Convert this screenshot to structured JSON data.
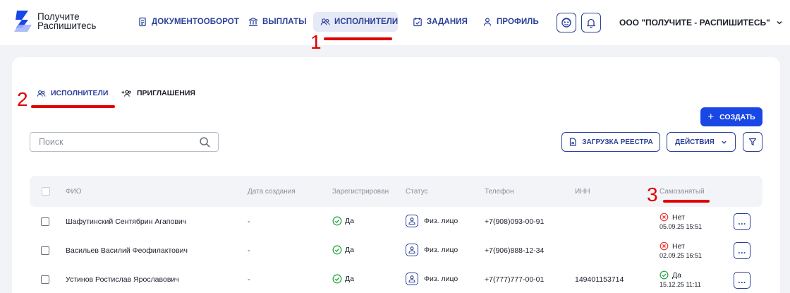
{
  "logo": {
    "line1": "Получите",
    "line2": "Распишитесь"
  },
  "nav": [
    {
      "label": "ДОКУМЕНТООБОРОТ",
      "icon": "document-icon"
    },
    {
      "label": "ВЫПЛАТЫ",
      "icon": "bank-icon"
    },
    {
      "label": "ИСПОЛНИТЕЛИ",
      "icon": "users-icon",
      "active": true
    },
    {
      "label": "ЗАДАНИЯ",
      "icon": "calendar-check-icon"
    },
    {
      "label": "ПРОФИЛЬ",
      "icon": "user-icon"
    }
  ],
  "header": {
    "organization": "ООО \"ПОЛУЧИТЕ - РАСПИШИТЕСЬ\""
  },
  "annotations": {
    "one": "1",
    "two": "2",
    "three": "3"
  },
  "tabs": {
    "executors": "ИСПОЛНИТЕЛИ",
    "invitations": "ПРИГЛАШЕНИЯ"
  },
  "toolbar": {
    "create": "СОЗДАТЬ",
    "upload_registry": "ЗАГРУЗКА РЕЕСТРА",
    "actions": "ДЕЙСТВИЯ",
    "search_placeholder": "Поиск"
  },
  "table": {
    "columns": {
      "fio": "ФИО",
      "created": "Дата создания",
      "registered": "Зарегистрирован",
      "status": "Статус",
      "phone": "Телефон",
      "inn": "ИНН",
      "self_employed": "Самозанятый"
    },
    "rows": [
      {
        "fio": "Шафутинский Сентябрин Агапович",
        "created": "-",
        "registered": "Да",
        "status": "Физ. лицо",
        "phone": "+7(908)093-00-91",
        "inn": "",
        "self_employed": "Нет",
        "self_date": "05.09.25 15:51"
      },
      {
        "fio": "Васильев Василий Феофилактович",
        "created": "-",
        "registered": "Да",
        "status": "Физ. лицо",
        "phone": "+7(906)888-12-34",
        "inn": "",
        "self_employed": "Нет",
        "self_date": "02.09.25 16:51"
      },
      {
        "fio": "Устинов Ростислав Ярославович",
        "created": "-",
        "registered": "Да",
        "status": "Физ. лицо",
        "phone": "+7(777)777-00-01",
        "inn": "149401153714",
        "self_employed": "Да",
        "self_date": "15.12.25 11:11"
      }
    ],
    "more_label": "..."
  },
  "colors": {
    "accent": "#2a3f99",
    "primary_button": "#1947e5",
    "success": "#27a844",
    "error": "#e53935",
    "annotation": "#e00000"
  }
}
